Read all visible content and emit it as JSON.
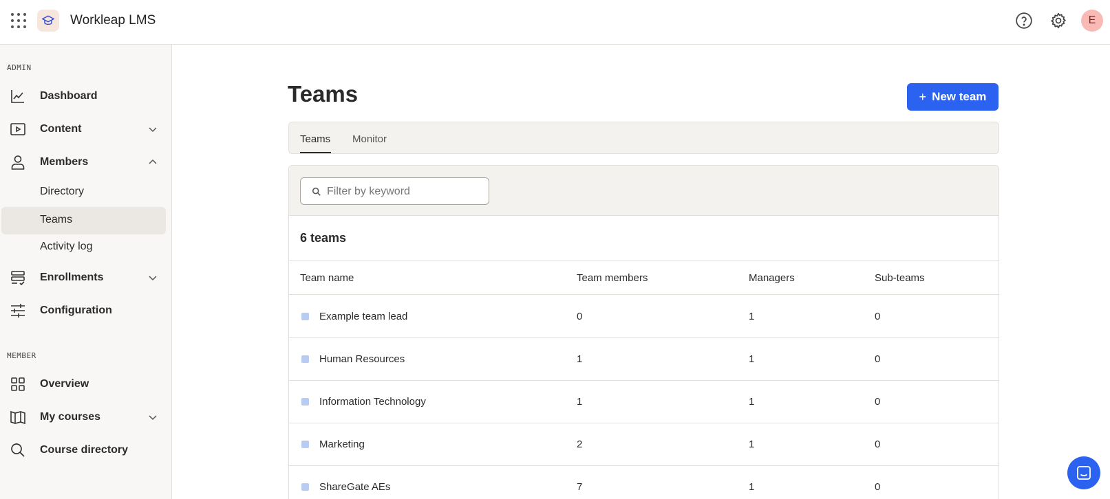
{
  "header": {
    "app_title": "Workleap LMS",
    "avatar_initial": "E",
    "icons": [
      "apps-grid-icon",
      "graduation-cap-icon",
      "help-icon",
      "settings-gear-icon"
    ]
  },
  "sidebar": {
    "admin_label": "ADMIN",
    "member_label": "MEMBER",
    "items": {
      "dashboard": "Dashboard",
      "content": "Content",
      "members": "Members",
      "directory": "Directory",
      "teams": "Teams",
      "activity_log": "Activity log",
      "enrollments": "Enrollments",
      "configuration": "Configuration",
      "overview": "Overview",
      "my_courses": "My courses",
      "course_directory": "Course directory"
    },
    "active_item": "Teams"
  },
  "main": {
    "title": "Teams",
    "new_button_label": "New team",
    "tabs": [
      {
        "label": "Teams",
        "active": true
      },
      {
        "label": "Monitor",
        "active": false
      }
    ],
    "search_placeholder": "Filter by keyword",
    "count_label": "6 teams",
    "columns": [
      "Team name",
      "Team members",
      "Managers",
      "Sub-teams"
    ],
    "rows": [
      {
        "name": "Example team lead",
        "members": "0",
        "managers": "1",
        "subteams": "0"
      },
      {
        "name": "Human Resources",
        "members": "1",
        "managers": "1",
        "subteams": "0"
      },
      {
        "name": "Information Technology",
        "members": "1",
        "managers": "1",
        "subteams": "0"
      },
      {
        "name": "Marketing",
        "members": "2",
        "managers": "1",
        "subteams": "0"
      },
      {
        "name": "ShareGate AEs",
        "members": "7",
        "managers": "1",
        "subteams": "0"
      }
    ]
  },
  "colors": {
    "accent": "#2c62f0",
    "team_dot": "#b8ccf3",
    "avatar_bg": "#f9b9b4",
    "sidebar_bg": "#f8f7f5",
    "active_item_bg": "#ebe8e3"
  }
}
